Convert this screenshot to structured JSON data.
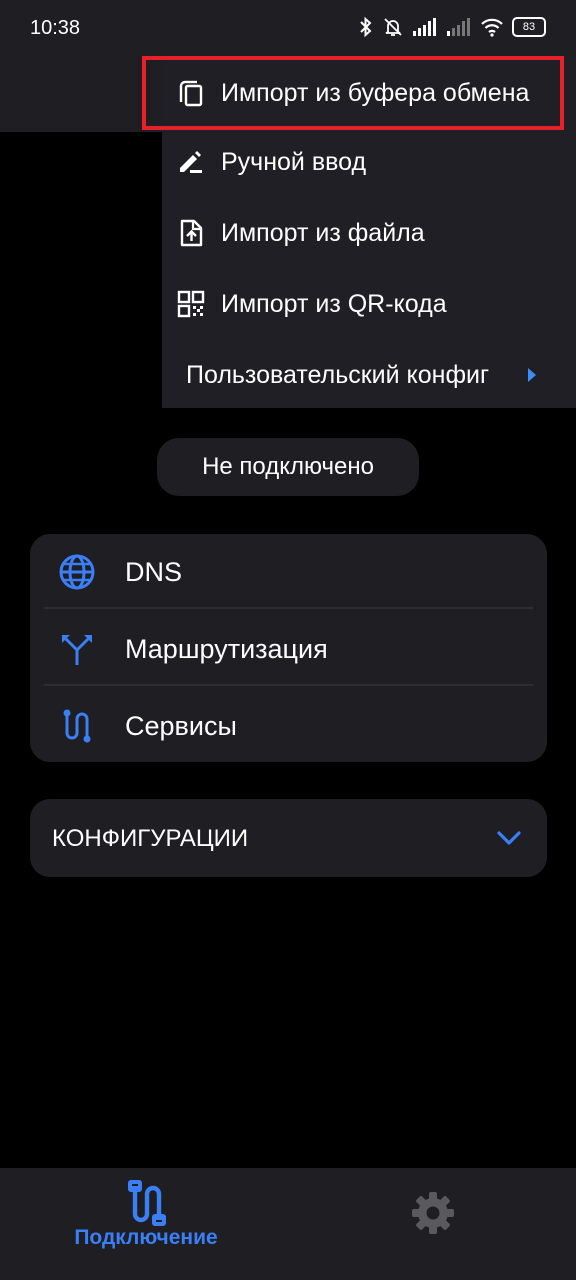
{
  "status_bar": {
    "time": "10:38",
    "battery": "83"
  },
  "menu": {
    "items": [
      {
        "label": "Импорт из буфера обмена",
        "icon": "copy-icon"
      },
      {
        "label": "Ручной ввод",
        "icon": "edit-pencil-icon"
      },
      {
        "label": "Импорт из файла",
        "icon": "file-upload-icon"
      },
      {
        "label": "Импорт из QR-кода",
        "icon": "qr-code-icon"
      }
    ],
    "submenu": {
      "label": "Пользовательский конфиг",
      "icon": "triangle-right-icon"
    }
  },
  "connection_status": "Не подключено",
  "settings_card": {
    "items": [
      {
        "label": "DNS",
        "icon": "globe-icon"
      },
      {
        "label": "Маршрутизация",
        "icon": "routing-fork-icon"
      },
      {
        "label": "Сервисы",
        "icon": "services-path-icon"
      }
    ]
  },
  "configs": {
    "label": "КОНФИГУРАЦИИ",
    "icon": "chevron-down-icon"
  },
  "bottom_nav": {
    "connect_label": "Подключение",
    "settings_icon": "gear-icon"
  },
  "colors": {
    "accent": "#3a7ff6",
    "highlight": "#e8202a",
    "surface": "#1f1e23",
    "background": "#000000"
  }
}
